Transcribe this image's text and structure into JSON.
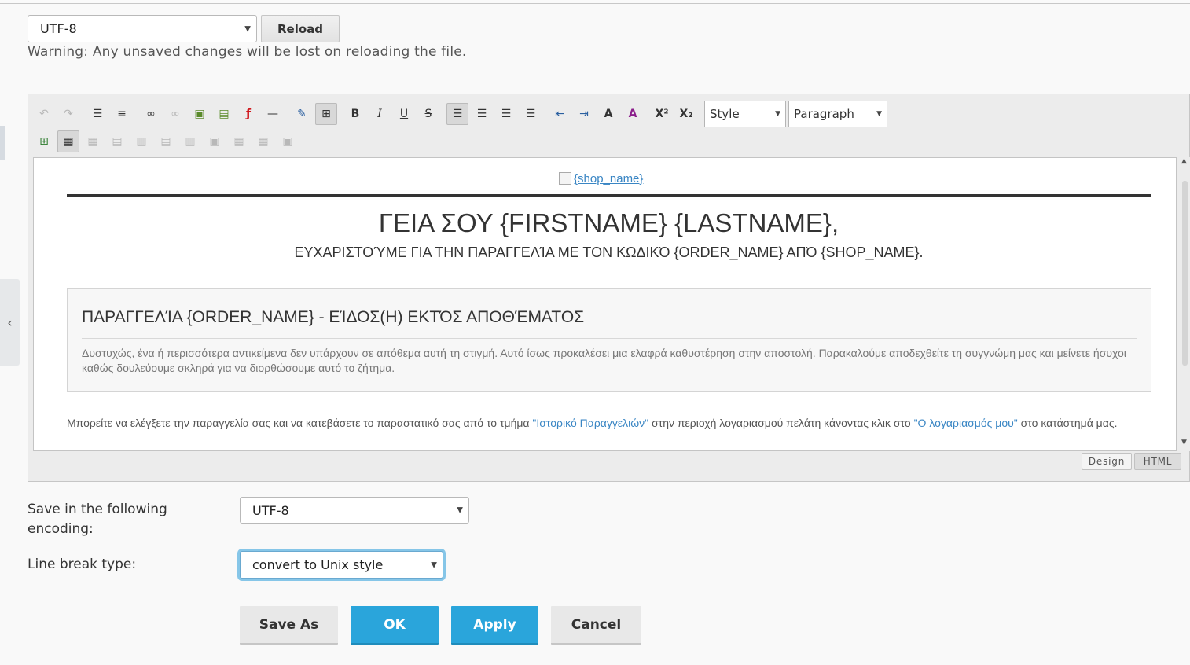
{
  "file_encoding": {
    "value": "UTF-8",
    "reload_label": "Reload"
  },
  "warning": "Warning: Any unsaved changes will be lost on reloading the file.",
  "toolbar": {
    "style_select": "Style",
    "paragraph_select": "Paragraph"
  },
  "editor_content": {
    "logo_alt": "{shop_name}",
    "greeting": "ΓΕΙΑ ΣΟΥ {FIRSTNAME} {LASTNAME},",
    "thanks": "ΕΥΧΑΡΙΣΤΟΎΜΕ ΓΙΑ ΤΗΝ ΠΑΡΑΓΓΕΛΊΑ ΜΕ ΤΟΝ ΚΩΔΙΚΌ {ORDER_NAME} ΑΠΌ {SHOP_NAME}.",
    "box_title": "ΠΑΡΑΓΓΕΛΊΑ {ORDER_NAME} - ΕΊΔΟΣ(Η) ΕΚΤΌΣ ΑΠΟΘΈΜΑΤΟΣ",
    "box_text": "Δυστυχώς, ένα ή περισσότερα αντικείμενα δεν υπάρχουν σε απόθεμα αυτή τη στιγμή. Αυτό ίσως προκαλέσει μια ελαφρά καθυστέρηση στην αποστολή. Παρακαλούμε αποδεχθείτε τη συγγνώμη μας και μείνετε ήσυχοι καθώς δουλεύουμε σκληρά για να διορθώσουμε αυτό το ζήτημα.",
    "para_1": "Μπορείτε να ελέγξετε την παραγγελία σας και να κατεβάσετε το παραστατικό σας από το τμήμα ",
    "link_history": "\"Ιστορικό Παραγγελιών\"",
    "para_2": " στην περιοχή λογαριασμού πελάτη κάνοντας κλικ στο ",
    "link_account": "\"Ο λογαριασμός μου\"",
    "para_3": " στο κατάστημά μας."
  },
  "mode_tabs": {
    "design": "Design",
    "html": "HTML"
  },
  "save_encoding": {
    "label": "Save in the following encoding:",
    "value": "UTF-8"
  },
  "line_break": {
    "label": "Line break type:",
    "value": "convert to Unix style"
  },
  "buttons": {
    "save_as": "Save As",
    "ok": "OK",
    "apply": "Apply",
    "cancel": "Cancel"
  },
  "colors": {
    "accent": "#2aa5db",
    "link": "#3a86c4",
    "focus": "#86c6e8"
  },
  "icons": [
    "undo-icon",
    "redo-icon",
    "ordered-list-icon",
    "unordered-list-icon",
    "link-icon",
    "unlink-icon",
    "image-icon",
    "image-manager-icon",
    "flash-icon",
    "horizontal-rule-icon",
    "edit-css-icon",
    "show-blocks-icon",
    "bold-icon",
    "italic-icon",
    "underline-icon",
    "strikethrough-icon",
    "align-left-icon",
    "align-center-icon",
    "align-right-icon",
    "align-justify-icon",
    "outdent-icon",
    "indent-icon",
    "text-color-icon",
    "background-color-icon",
    "superscript-icon",
    "subscript-icon",
    "table-insert-icon",
    "table-props-icon",
    "cell-props-icon",
    "row-before-icon",
    "col-before-icon",
    "row-after-icon",
    "col-after-icon",
    "delete-row-icon",
    "delete-col-icon",
    "split-cells-icon",
    "merge-cells-icon",
    "chevron-left-icon"
  ]
}
